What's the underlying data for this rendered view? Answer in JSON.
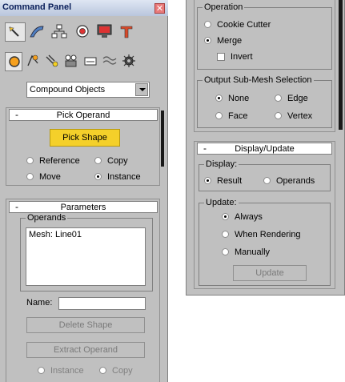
{
  "window_title": "Command Panel",
  "close_glyph": "✕",
  "toolbar_top": [
    "create-icon",
    "modify-icon",
    "hierarchy-icon",
    "motion-icon",
    "display-icon",
    "utilities-icon"
  ],
  "toolbar_sub": [
    "geometry-icon",
    "shapes-icon",
    "lights-icon",
    "cameras-icon",
    "helpers-icon",
    "space-warps-icon",
    "systems-icon"
  ],
  "category": {
    "value": "Compound Objects"
  },
  "pick_operand": {
    "title": "Pick Operand",
    "minus": "-",
    "pick_shape": "Pick Shape",
    "options": [
      {
        "label": "Reference",
        "selected": false
      },
      {
        "label": "Copy",
        "selected": false
      },
      {
        "label": "Move",
        "selected": false
      },
      {
        "label": "Instance",
        "selected": true
      }
    ]
  },
  "parameters": {
    "title": "Parameters",
    "minus": "-",
    "operands_label": "Operands",
    "operands": [
      "Mesh: Line01"
    ],
    "name_label": "Name:",
    "delete_shape": "Delete Shape",
    "extract_operand": "Extract Operand",
    "extract_options": [
      {
        "label": "Instance",
        "selected": false
      },
      {
        "label": "Copy",
        "selected": false
      }
    ]
  },
  "operation": {
    "label": "Operation",
    "options": [
      {
        "label": "Cookie Cutter",
        "selected": false
      },
      {
        "label": "Merge",
        "selected": true
      }
    ],
    "invert": {
      "label": "Invert",
      "checked": false
    }
  },
  "output_submesh": {
    "label": "Output Sub-Mesh Selection",
    "options": [
      {
        "label": "None",
        "selected": true
      },
      {
        "label": "Edge",
        "selected": false
      },
      {
        "label": "Face",
        "selected": false
      },
      {
        "label": "Vertex",
        "selected": false
      }
    ]
  },
  "display_update": {
    "title": "Display/Update",
    "minus": "-",
    "display": {
      "label": "Display:",
      "options": [
        {
          "label": "Result",
          "selected": true
        },
        {
          "label": "Operands",
          "selected": false
        }
      ]
    },
    "update": {
      "label": "Update:",
      "options": [
        {
          "label": "Always",
          "selected": true
        },
        {
          "label": "When Rendering",
          "selected": false
        },
        {
          "label": "Manually",
          "selected": false
        }
      ],
      "button": "Update"
    }
  }
}
